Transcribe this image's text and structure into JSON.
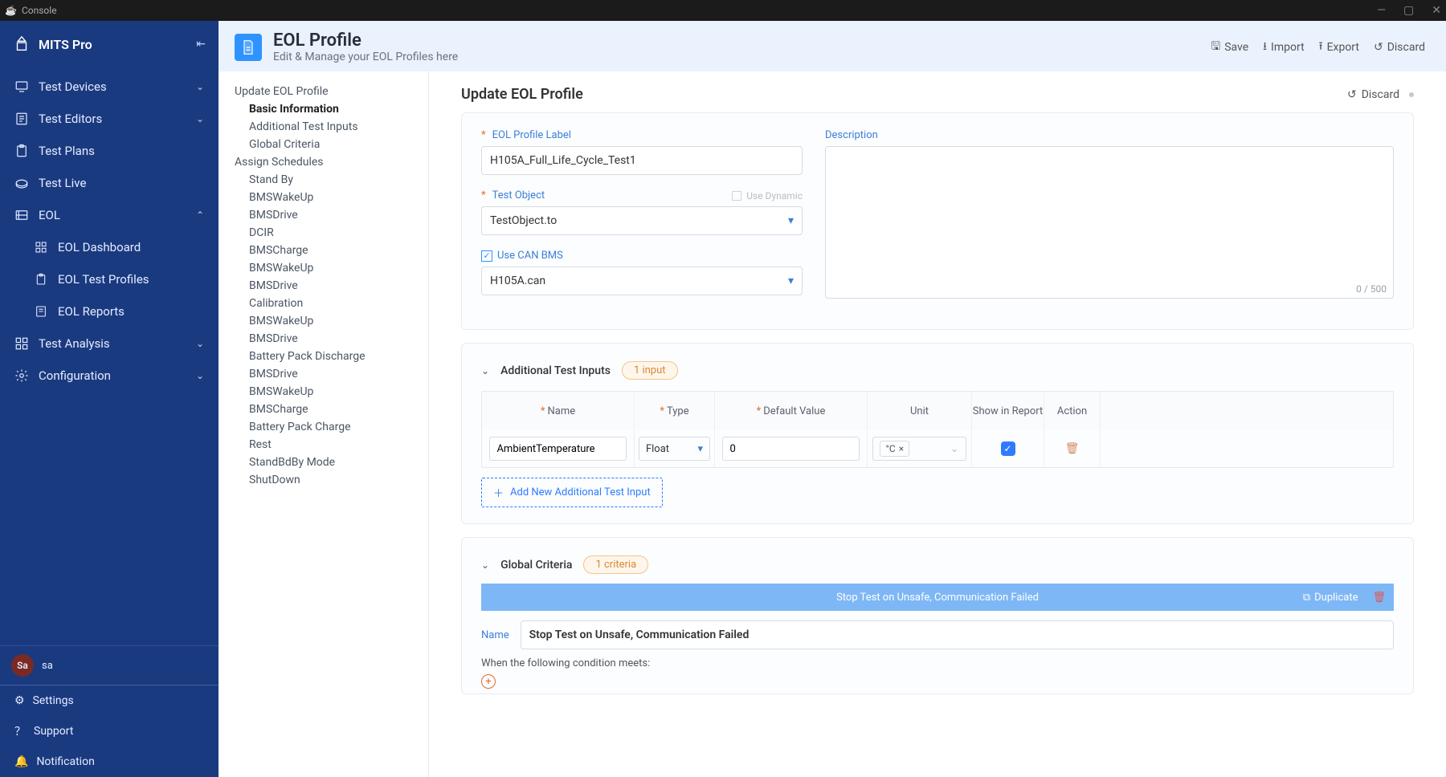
{
  "window": {
    "title": "Console"
  },
  "brand": {
    "name": "MITS Pro"
  },
  "sidebar": {
    "items": [
      {
        "label": "Test Devices",
        "icon": "devices",
        "expandable": true
      },
      {
        "label": "Test Editors",
        "icon": "editors",
        "expandable": true
      },
      {
        "label": "Test Plans",
        "icon": "plans"
      },
      {
        "label": "Test Live",
        "icon": "live"
      },
      {
        "label": "EOL",
        "icon": "eol",
        "expanded": true,
        "children": [
          {
            "label": "EOL Dashboard",
            "icon": "grid"
          },
          {
            "label": "EOL Test Profiles",
            "icon": "clipboard"
          },
          {
            "label": "EOL Reports",
            "icon": "reports"
          }
        ]
      },
      {
        "label": "Test Analysis",
        "icon": "analysis",
        "expandable": true
      },
      {
        "label": "Configuration",
        "icon": "gear",
        "expandable": true
      }
    ],
    "user": {
      "initials": "Sa",
      "name": "sa"
    },
    "footer": [
      {
        "label": "Settings",
        "icon": "gear"
      },
      {
        "label": "Support",
        "icon": "help"
      },
      {
        "label": "Notification",
        "icon": "bell"
      }
    ]
  },
  "page": {
    "title": "EOL Profile",
    "subtitle": "Edit & Manage your EOL Profiles here",
    "actions": {
      "save": "Save",
      "import": "Import",
      "export": "Export",
      "discard": "Discard"
    }
  },
  "outline": {
    "section1": {
      "title": "Update EOL Profile",
      "items": [
        "Basic Information",
        "Additional Test Inputs",
        "Global Criteria"
      ]
    },
    "section2": {
      "title": "Assign Schedules",
      "items": [
        "Stand By",
        "BMSWakeUp",
        "BMSDrive",
        "DCIR",
        "BMSCharge",
        "BMSWakeUp",
        "BMSDrive",
        "Calibration",
        "BMSWakeUp",
        "BMSDrive",
        "Battery Pack Discharge",
        "BMSDrive",
        "BMSWakeUp",
        "BMSCharge",
        "Battery Pack Charge",
        "Rest",
        "StandBdBy Mode",
        "ShutDown"
      ]
    }
  },
  "form": {
    "title": "Update EOL Profile",
    "discard": "Discard",
    "labels": {
      "profile": "EOL Profile Label",
      "description": "Description",
      "testObject": "Test Object",
      "useDynamic": "Use Dynamic",
      "useCan": "Use CAN BMS"
    },
    "values": {
      "profile": "H105A_Full_Life_Cycle_Test1",
      "testObject": "TestObject.to",
      "can": "H105A.can"
    },
    "descCounter": "0 / 500"
  },
  "addInputs": {
    "title": "Additional Test Inputs",
    "badge": "1 input",
    "cols": {
      "name": "Name",
      "type": "Type",
      "def": "Default Value",
      "unit": "Unit",
      "show": "Show in Report",
      "action": "Action"
    },
    "row": {
      "name": "AmbientTemperature",
      "type": "Float",
      "def": "0",
      "unit": "°C",
      "show": true
    },
    "addNew": "Add New Additional Test Input"
  },
  "criteria": {
    "title": "Global Criteria",
    "badge": "1 criteria",
    "barText": "Stop Test on Unsafe, Communication Failed",
    "duplicate": "Duplicate",
    "nameLabel": "Name",
    "nameValue": "Stop Test on Unsafe, Communication Failed",
    "condText": "When the following condition meets:"
  }
}
